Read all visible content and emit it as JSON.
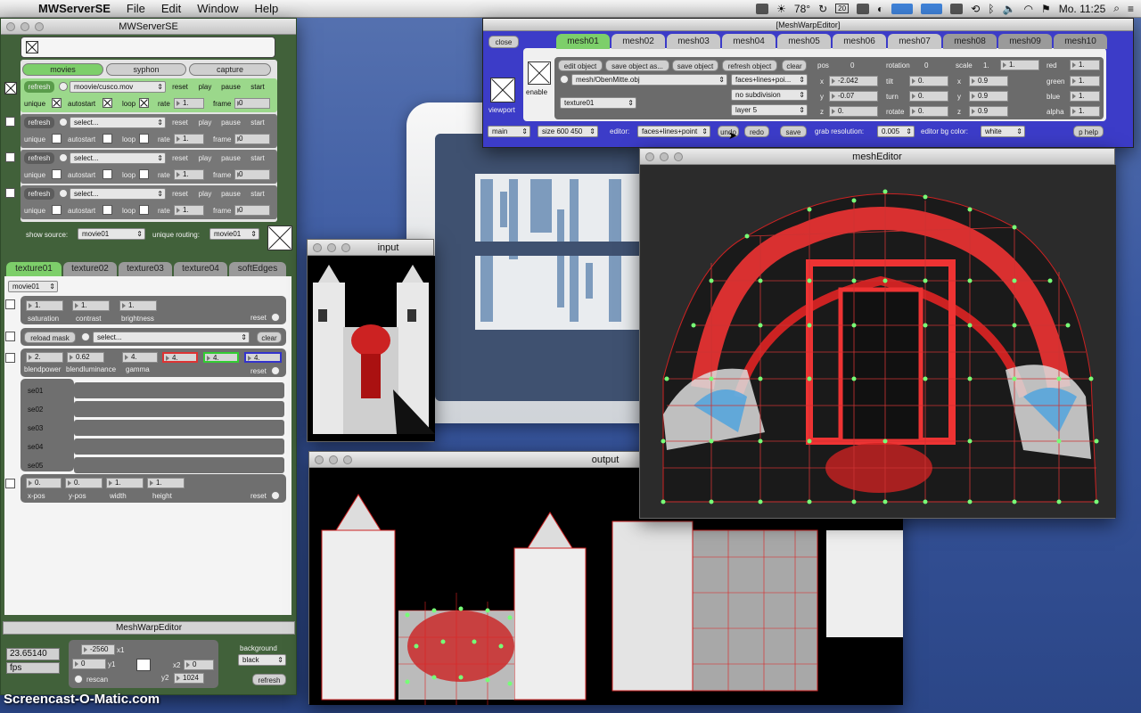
{
  "menubar": {
    "app": "MWServerSE",
    "items": [
      "File",
      "Edit",
      "Window",
      "Help"
    ],
    "temp": "78°",
    "badge": "20",
    "clock": "Mo. 11:25"
  },
  "server": {
    "title": "MWServerSE",
    "source_tabs": [
      "movies",
      "syphon",
      "capture"
    ],
    "rows": [
      {
        "file": "moovie/cusco.mov",
        "rate": "1.",
        "frame": "0"
      },
      {
        "file": "select...",
        "rate": "1.",
        "frame": "0"
      },
      {
        "file": "select...",
        "rate": "1.",
        "frame": "0"
      },
      {
        "file": "select...",
        "rate": "1.",
        "frame": "0"
      }
    ],
    "btn": {
      "refresh": "refresh",
      "reset": "reset",
      "play": "play",
      "pause": "pause",
      "start": "start"
    },
    "lbl": {
      "unique": "unique",
      "autostart": "autostart",
      "loop": "loop",
      "rate": "rate",
      "frame": "frame"
    },
    "show_source_label": "show source:",
    "show_source_value": "movie01",
    "unique_routing_label": "unique routing:",
    "unique_routing_value": "movie01",
    "texture_tabs": [
      "texture01",
      "texture02",
      "texture03",
      "texture04",
      "softEdges"
    ],
    "texture_movie": "movie01",
    "adjust": {
      "saturation": "1.",
      "contrast": "1.",
      "brightness": "1.",
      "sat_label": "saturation",
      "con_label": "contrast",
      "bri_label": "brightness",
      "reset": "reset"
    },
    "mask": {
      "button": "reload mask",
      "select": "select...",
      "clear": "clear"
    },
    "blend": {
      "power": "2.",
      "luminance": "0.62",
      "gamma": "4.",
      "r": "4.",
      "g": "4.",
      "b": "4.",
      "power_label": "blendpower",
      "lum_label": "blendluminance",
      "gamma_label": "gamma",
      "reset": "reset"
    },
    "se": [
      "se01",
      "se02",
      "se03",
      "se04",
      "se05"
    ],
    "pos": {
      "x": "0.",
      "y": "0.",
      "w": "1.",
      "h": "1.",
      "x_label": "x-pos",
      "y_label": "y-pos",
      "w_label": "width",
      "h_label": "height",
      "reset": "reset"
    },
    "mesh_bar": "MeshWarpEditor",
    "fps_value": "23.65140",
    "fps_label": "fps",
    "x1": "-2560",
    "x1_label": "x1",
    "y1": "0",
    "y1_label": "y1",
    "x2": "0",
    "x2_label": "x2",
    "y2": "1024",
    "y2_label": "y2",
    "rescan": "rescan",
    "background_label": "background",
    "background_value": "black",
    "refresh": "refresh"
  },
  "mesheditor": {
    "title": "[MeshWarpEditor]",
    "close": "close",
    "viewport": "viewport",
    "enable": "enable",
    "tabs": [
      "mesh01",
      "mesh02",
      "mesh03",
      "mesh04",
      "mesh05",
      "mesh06",
      "mesh07",
      "mesh08",
      "mesh09",
      "mesh10"
    ],
    "actions": [
      "edit object",
      "save object as...",
      "save object",
      "refresh object",
      "clear"
    ],
    "file": "mesh/ObenMitte.obj",
    "texture": "texture01",
    "render": "faces+lines+poi...",
    "subdivision": "no subdivision",
    "layer": "layer 5",
    "pos": {
      "label": "pos",
      "val": "0",
      "x": "-2.042",
      "y": "-0.07",
      "z": "0.",
      "x_label": "x",
      "y_label": "y",
      "z_label": "z"
    },
    "rot": {
      "label": "rotation",
      "val": "0",
      "tilt": "0.",
      "turn": "0.",
      "rotate": "0.",
      "tilt_label": "tilt",
      "turn_label": "turn",
      "rotate_label": "rotate"
    },
    "scale": {
      "label": "scale",
      "val": "1.",
      "val2": "1.",
      "x": "0.9",
      "y": "0.9",
      "z": "0.9"
    },
    "color": {
      "red": "1.",
      "green": "1.",
      "blue": "1.",
      "alpha": "1.",
      "red_label": "red",
      "green_label": "green",
      "blue_label": "blue",
      "alpha_label": "alpha"
    },
    "bottom": {
      "main": "main",
      "size": "size 600 450",
      "editor_label": "editor:",
      "editor": "faces+lines+point",
      "undo": "undo",
      "redo": "redo",
      "save": "save",
      "grab_label": "grab resolution:",
      "grab": "0.005",
      "bgcolor_label": "editor bg color:",
      "bgcolor": "white",
      "help": "p help"
    }
  },
  "windows": {
    "input": "input",
    "output": "output",
    "mesh": "meshEditor"
  },
  "watermark": "Screencast-O-Matic.com",
  "colors": {
    "panel_green": "#41613a",
    "editor_blue": "#3c3cc8",
    "active_tab": "#7dcf6a"
  }
}
